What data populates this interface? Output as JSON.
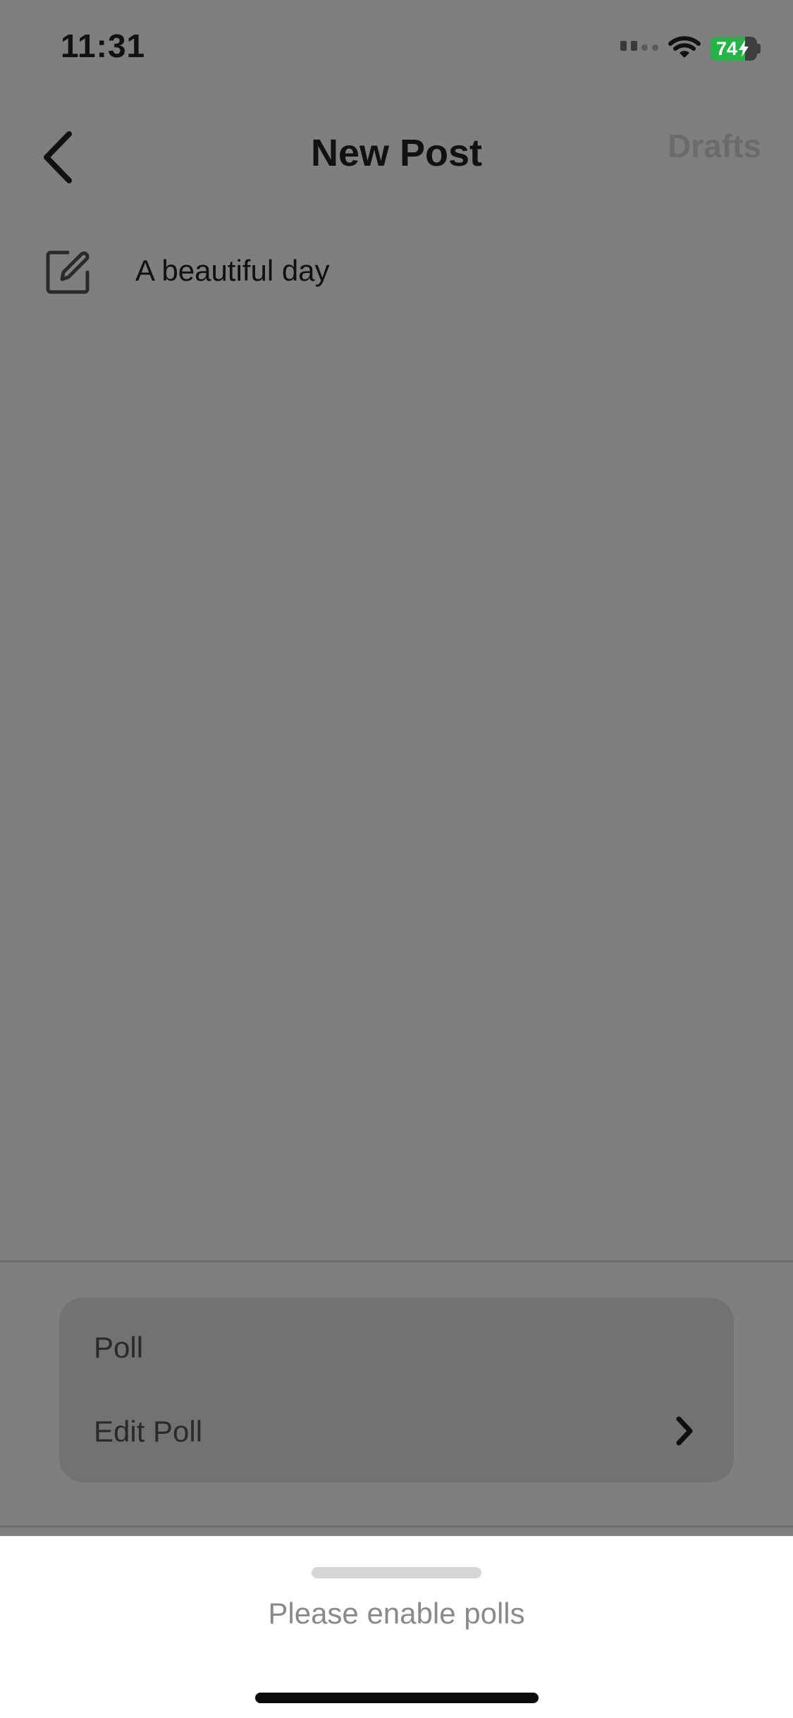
{
  "status_bar": {
    "time": "11:31",
    "battery_percent": "74",
    "battery_level": 0.74,
    "battery_charging": true
  },
  "header": {
    "back_icon": "chevron-left-icon",
    "title": "New Post",
    "drafts_label": "Drafts"
  },
  "post": {
    "icon": "edit-icon",
    "text": "A beautiful day"
  },
  "options": {
    "poll_label": "Poll",
    "edit_poll_label": "Edit Poll",
    "edit_poll_icon": "chevron-right-icon"
  },
  "sheet": {
    "message": "Please enable polls"
  },
  "colors": {
    "overlay_background": "#7f7f7f",
    "battery_green": "#27b24a",
    "sheet_background": "#ffffff",
    "muted_text": "#8a8a8a"
  }
}
